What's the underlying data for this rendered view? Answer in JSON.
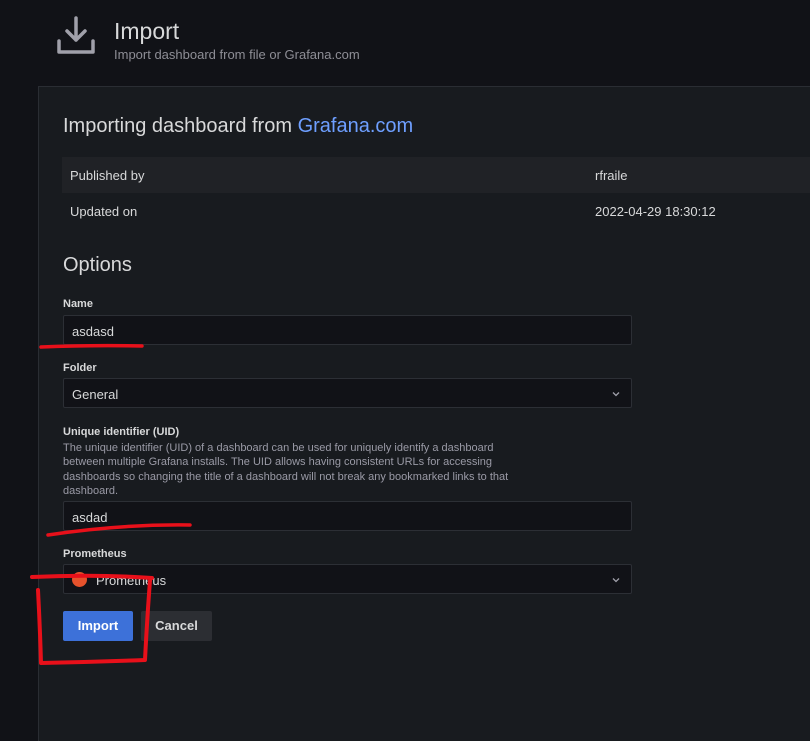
{
  "header": {
    "title": "Import",
    "subtitle": "Import dashboard from file or Grafana.com"
  },
  "panel": {
    "title_prefix": "Importing dashboard from ",
    "title_link": "Grafana.com",
    "info": [
      {
        "label": "Published by",
        "value": "rfraile"
      },
      {
        "label": "Updated on",
        "value": "2022-04-29 18:30:12"
      }
    ]
  },
  "options": {
    "title": "Options",
    "name": {
      "label": "Name",
      "value": "asdasd"
    },
    "folder": {
      "label": "Folder",
      "value": "General"
    },
    "uid": {
      "label": "Unique identifier (UID)",
      "description": "The unique identifier (UID) of a dashboard can be used for uniquely identify a dashboard between multiple Grafana installs. The UID allows having consistent URLs for accessing dashboards so changing the title of a dashboard will not break any bookmarked links to that dashboard.",
      "value": "asdad"
    },
    "prometheus": {
      "label": "Prometheus",
      "value": "Prometheus"
    }
  },
  "buttons": {
    "import": "Import",
    "cancel": "Cancel"
  },
  "colors": {
    "accent": "#3d71d9",
    "link": "#6e9fff",
    "annotation": "#e8101a"
  }
}
